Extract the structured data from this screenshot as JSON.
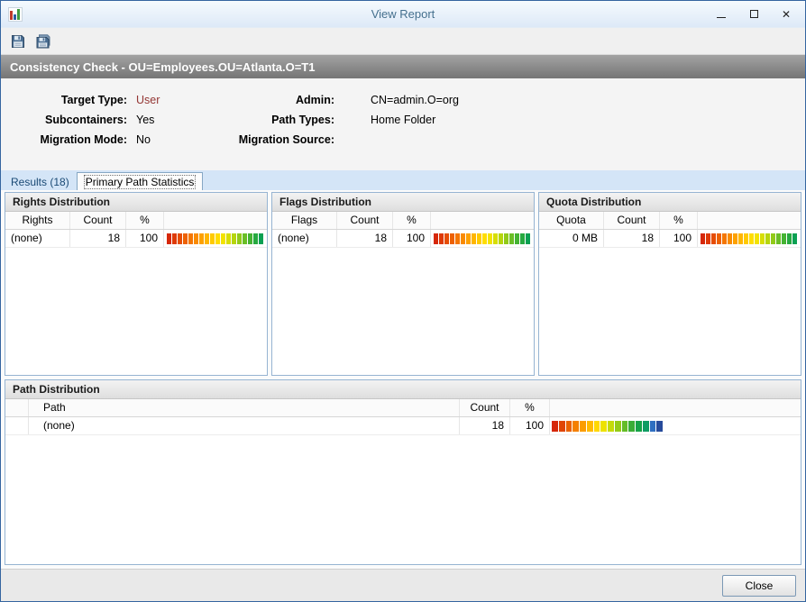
{
  "window": {
    "title": "View Report"
  },
  "icons": {
    "app": "report-chart-icon",
    "titlebar": [
      "minimize-icon",
      "maximize-icon",
      "close-icon"
    ],
    "toolbar": [
      "save-icon",
      "save-all-icon"
    ]
  },
  "report_header": {
    "title": "Consistency Check - OU=Employees.OU=Atlanta.O=T1"
  },
  "info": {
    "rows": [
      {
        "l1": "Target Type:",
        "v1": "User",
        "l2": "Admin:",
        "v2": "CN=admin.O=org"
      },
      {
        "l1": "Subcontainers:",
        "v1": "Yes",
        "l2": "Path Types:",
        "v2": "Home Folder"
      },
      {
        "l1": "Migration Mode:",
        "v1": "No",
        "l2": "Migration Source:",
        "v2": ""
      }
    ],
    "user_value_style": "color:#943634;"
  },
  "tabs": {
    "results": "Results  (18)",
    "primary": "Primary Path Statistics"
  },
  "panels": [
    {
      "title": "Rights Distribution",
      "col1": "Rights",
      "col2": "Count",
      "col3": "%",
      "row": {
        "name": "(none)",
        "count": "18",
        "pct": "100"
      }
    },
    {
      "title": "Flags Distribution",
      "col1": "Flags",
      "col2": "Count",
      "col3": "%",
      "row": {
        "name": "(none)",
        "count": "18",
        "pct": "100"
      }
    },
    {
      "title": "Quota Distribution",
      "col1": "Quota",
      "col2": "Count",
      "col3": "%",
      "row": {
        "name": "0 MB",
        "count": "18",
        "pct": "100"
      }
    }
  ],
  "path_panel": {
    "title": "Path Distribution",
    "col_path": "Path",
    "col_count": "Count",
    "col_pct": "%",
    "row": {
      "name": "(none)",
      "count": "18",
      "pct": "100"
    }
  },
  "footer": {
    "close": "Close"
  },
  "bars": {
    "full": [
      "#d6280a",
      "#de3a07",
      "#e64d05",
      "#ed6103",
      "#f47602",
      "#f98b01",
      "#fda100",
      "#ffb600",
      "#ffca00",
      "#ffdd00",
      "#f3e300",
      "#d7de04",
      "#b6d50d",
      "#91ca19",
      "#6abe26",
      "#45b333",
      "#26a940",
      "#0aa052"
    ],
    "path": [
      "#d6280a",
      "#e04505",
      "#ea6202",
      "#f48000",
      "#fb9d00",
      "#ffba00",
      "#ffd800",
      "#eee200",
      "#c4da08",
      "#94cb16",
      "#64bc27",
      "#3aad36",
      "#16a247",
      "#0f9d63",
      "#2f6fc1",
      "#274b9b"
    ]
  }
}
